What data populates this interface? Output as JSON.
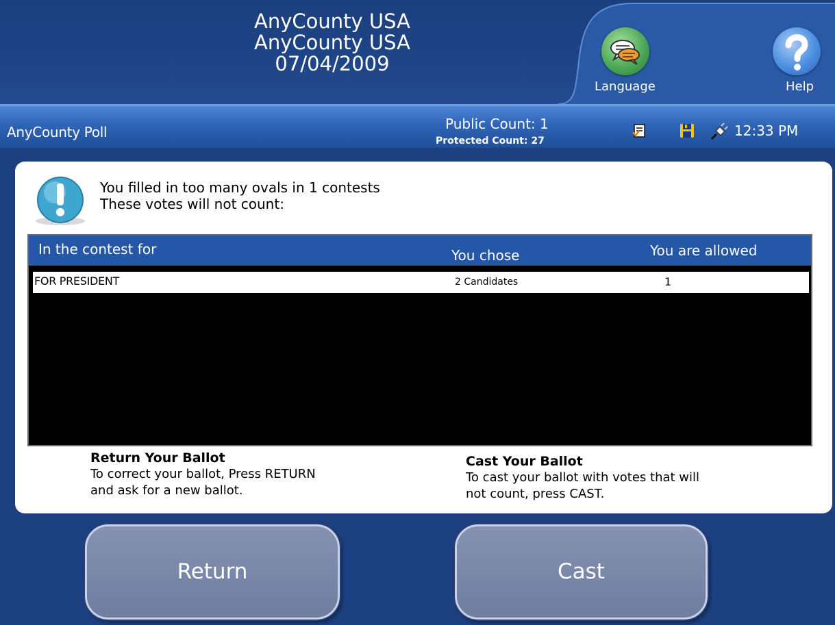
{
  "header": {
    "line1": "AnyCounty USA",
    "line2": "AnyCounty USA",
    "date": "07/04/2009",
    "language_label": "Language",
    "help_label": "Help"
  },
  "status": {
    "poll_name": "AnyCounty Poll",
    "public_count": "Public Count: 1",
    "protected_count": "Protected Count: 27",
    "time": "12:33 PM",
    "icons": [
      "ballot-check-icon",
      "save-disk-icon",
      "power-plug-icon"
    ]
  },
  "dialog": {
    "message_line1": "You filled in too many ovals in 1 contests",
    "message_line2": "These votes will not count:",
    "table": {
      "headers": [
        "In the contest for",
        "You chose",
        "You are allowed"
      ],
      "rows": [
        {
          "contest": "FOR PRESIDENT",
          "chose": "2 Candidates",
          "allowed": "1"
        }
      ]
    },
    "return_title": "Return Your Ballot",
    "return_line1": "To correct your ballot, Press RETURN",
    "return_line2": "and ask for a new ballot.",
    "cast_title": "Cast Your Ballot",
    "cast_line1": "To cast your ballot with votes that will",
    "cast_line2": "not count, press CAST."
  },
  "buttons": {
    "return_label": "Return",
    "cast_label": "Cast"
  },
  "colors": {
    "background": "#1c3f80",
    "header": "#1b3e7d",
    "statusbar": "#2f64b6",
    "table_header": "#2557a8",
    "button": "#7a87a8"
  }
}
